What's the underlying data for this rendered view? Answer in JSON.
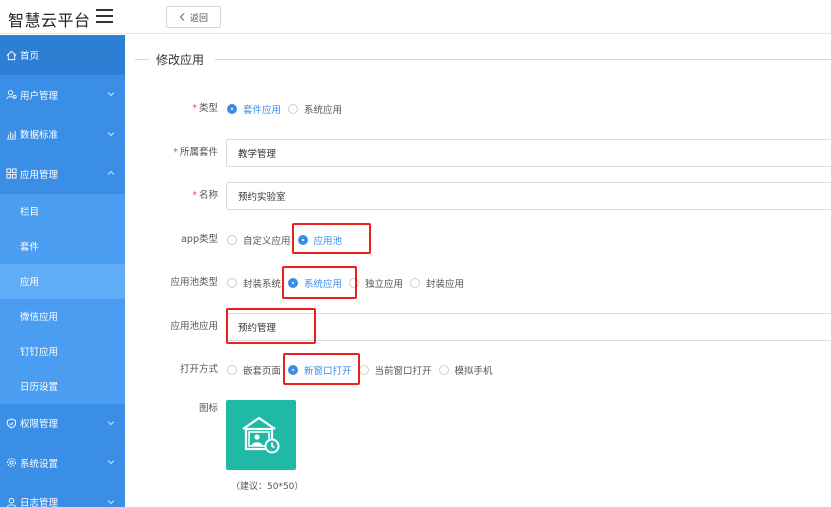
{
  "app": {
    "brand": "智慧云平台",
    "back_label": "返回"
  },
  "sidebar": {
    "home": "首页",
    "user_mgmt": "用户管理",
    "data_std": "数据标准",
    "app_mgmt": "应用管理",
    "sub_items": [
      "栏目",
      "套件",
      "应用",
      "微信应用",
      "钉钉应用",
      "日历设置"
    ],
    "perm_mgmt": "权限管理",
    "sys_settings": "系统设置",
    "log_mgmt": "日志管理"
  },
  "form": {
    "section_title": "修改应用",
    "type": {
      "label": "类型",
      "options": [
        "套件应用",
        "系统应用"
      ],
      "selected": "套件应用"
    },
    "suite": {
      "label": "所属套件",
      "value": "教学管理"
    },
    "name": {
      "label": "名称",
      "value": "预约实验室"
    },
    "app_type": {
      "label": "app类型",
      "options": [
        "自定义应用",
        "应用池"
      ],
      "selected": "应用池"
    },
    "pool_type": {
      "label": "应用池类型",
      "options": [
        "封装系统",
        "系统应用",
        "独立应用",
        "封装应用"
      ],
      "selected": "系统应用"
    },
    "pool_app": {
      "label": "应用池应用",
      "value": "预约管理"
    },
    "open_mode": {
      "label": "打开方式",
      "options": [
        "嵌套页面",
        "新窗口打开",
        "当前窗口打开",
        "模拟手机"
      ],
      "selected": "新窗口打开"
    },
    "icon": {
      "label": "图标",
      "hint": "（建议：50*50）"
    }
  },
  "colors": {
    "sidebar": "#3a8ee6",
    "accent": "#3a8ee6",
    "icon_bg": "#1fb9a6",
    "highlight": "#e8211f"
  }
}
